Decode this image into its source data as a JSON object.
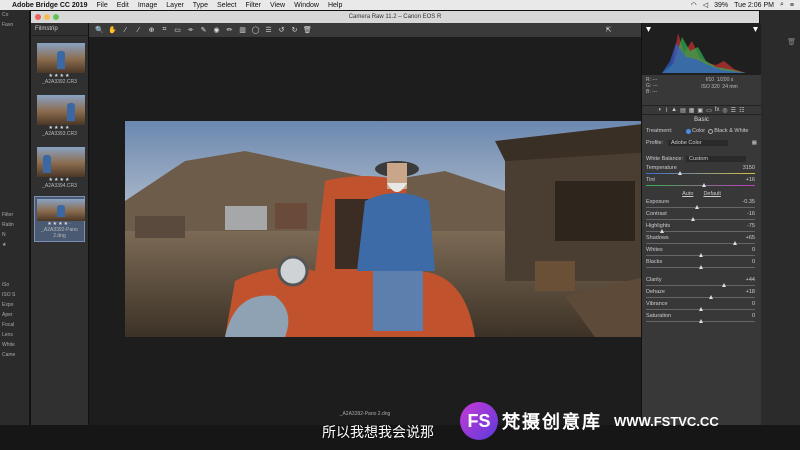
{
  "menubar": {
    "app_name": "Adobe Bridge CC 2019",
    "items": [
      "File",
      "Edit",
      "Image",
      "Layer",
      "Type",
      "Select",
      "Filter",
      "View",
      "Window",
      "Help"
    ],
    "battery": "39%",
    "clock": "Tue 2:06 PM"
  },
  "window": {
    "title": "Camera Raw 11.2 – Canon EOS R"
  },
  "filmstrip": {
    "header": "Filmstrip",
    "thumbs": [
      {
        "stars": "★★★★",
        "filename": "_A2A3392.CR3"
      },
      {
        "stars": "★★★★",
        "filename": "_A2A3393.CR3"
      },
      {
        "stars": "★★★★",
        "filename": "_A2A3394.CR3"
      },
      {
        "stars": "★★★★·",
        "filename": "_A2A3392-Pano 2.dng"
      }
    ]
  },
  "preview": {
    "footer_filename": "_A2A3392-Pano 2.dng"
  },
  "bridge_left": {
    "rows": [
      "Co",
      "Favo",
      "",
      "",
      "",
      "",
      "",
      "",
      "",
      "",
      "",
      "",
      "",
      "",
      "",
      "",
      "",
      "",
      "",
      "",
      "Filter",
      "Ratin",
      "N",
      "★",
      "",
      "",
      "",
      "iSo",
      "ISO S",
      "Expo",
      "Aper",
      "Focal",
      "Lens",
      "White",
      "Came"
    ]
  },
  "info": {
    "r": "R:",
    "g": "G:",
    "b": "B:",
    "r_val": "---",
    "g_val": "---",
    "b_val": "---",
    "aperture": "f/10",
    "shutter": "1/200 s",
    "iso": "ISO 320",
    "focal": "24 mm"
  },
  "panel": {
    "section": "Basic",
    "treatment_label": "Treatment:",
    "treatment_color": "Color",
    "treatment_bw": "Black & White",
    "profile_label": "Profile:",
    "profile_value": "Adobe Color",
    "wb_label": "White Balance:",
    "wb_value": "Custom",
    "auto": "Auto",
    "default": "Default",
    "sliders": [
      {
        "label": "Temperature",
        "value": "3150",
        "pos": 0.3
      },
      {
        "label": "Tint",
        "value": "+16",
        "pos": 0.53
      },
      {
        "label": "Exposure",
        "value": "-0.35",
        "pos": 0.46
      },
      {
        "label": "Contrast",
        "value": "-16",
        "pos": 0.42
      },
      {
        "label": "Highlights",
        "value": "-75",
        "pos": 0.13
      },
      {
        "label": "Shadows",
        "value": "+65",
        "pos": 0.82
      },
      {
        "label": "Whites",
        "value": "0",
        "pos": 0.5
      },
      {
        "label": "Blacks",
        "value": "0",
        "pos": 0.5
      },
      {
        "label": "Clarity",
        "value": "+44",
        "pos": 0.72
      },
      {
        "label": "Dehaze",
        "value": "+18",
        "pos": 0.59
      },
      {
        "label": "Vibrance",
        "value": "0",
        "pos": 0.5
      },
      {
        "label": "Saturation",
        "value": "0",
        "pos": 0.5
      }
    ]
  },
  "subtitle": "所以我想我会说那",
  "brand": {
    "logo": "FS",
    "cn": "梵摄创意库",
    "url": "WWW.FSTVC.CC"
  },
  "colors": {
    "accent": "#4a8ee8",
    "selected_thumb": "#4a5a72"
  }
}
